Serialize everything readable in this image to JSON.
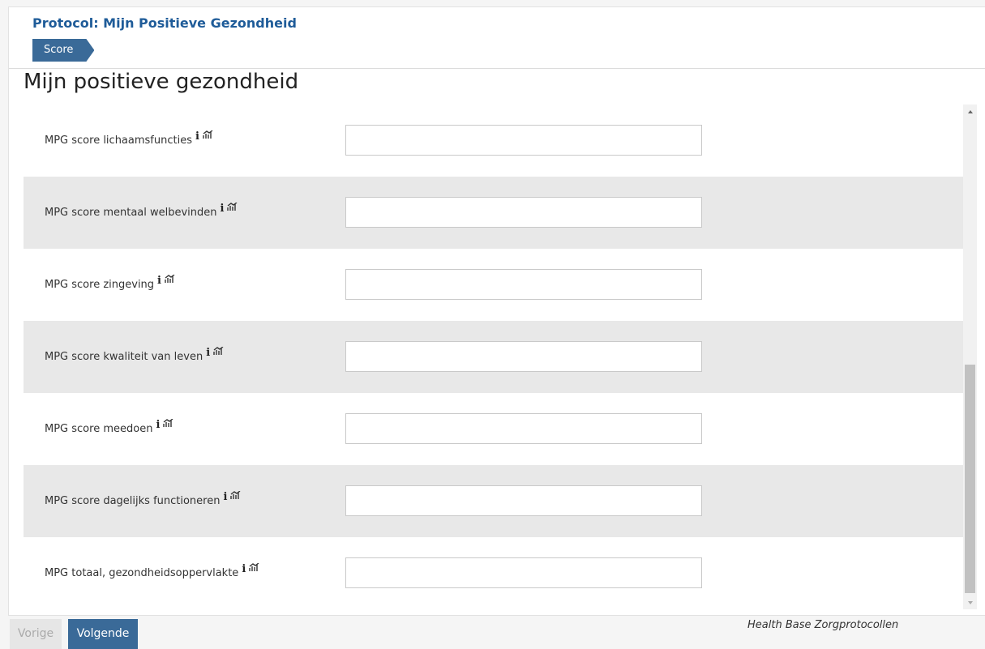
{
  "header": {
    "protocol_title": "Protocol: Mijn Positieve Gezondheid",
    "tab_label": "Score"
  },
  "page_title": "Mijn positieve gezondheid",
  "icons": {
    "info": "i",
    "chart": "chart-icon"
  },
  "rows": [
    {
      "label": "MPG score lichaamsfuncties",
      "value": ""
    },
    {
      "label": "MPG score mentaal welbevinden",
      "value": ""
    },
    {
      "label": "MPG score zingeving",
      "value": ""
    },
    {
      "label": "MPG score kwaliteit van leven",
      "value": ""
    },
    {
      "label": "MPG score meedoen",
      "value": ""
    },
    {
      "label": "MPG score dagelijks functioneren",
      "value": ""
    },
    {
      "label": "MPG totaal, gezondheidsoppervlakte",
      "value": ""
    }
  ],
  "footer": {
    "prev_label": "Vorige",
    "next_label": "Volgende",
    "brand": "Health Base Zorgprotocollen"
  },
  "colors": {
    "accent": "#3a6a98",
    "title": "#1f5c99",
    "row_alt": "#e8e8e8"
  }
}
